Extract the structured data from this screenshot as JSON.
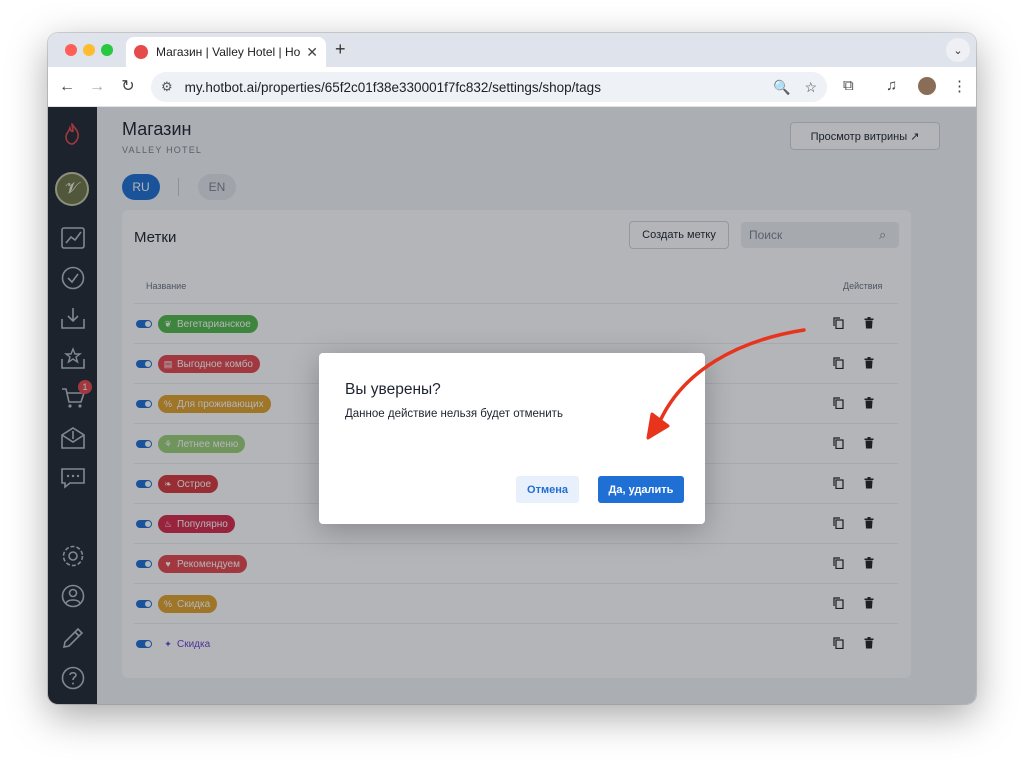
{
  "browser": {
    "tab_title": "Магазин | Valley Hotel | Hotbot",
    "url": "my.hotbot.ai/properties/65f2c01f38e330001f7fc832/settings/shop/tags",
    "new_tab_symbol": "+",
    "tab_close_symbol": "✕"
  },
  "header": {
    "title": "Магазин",
    "subtitle": "VALLEY HOTEL",
    "preview_button": "Просмотр витрины ↗"
  },
  "languages": [
    {
      "code": "RU",
      "active": true
    },
    {
      "code": "EN",
      "active": false
    }
  ],
  "sidebar": {
    "cart_badge": "1"
  },
  "tags_card": {
    "title": "Метки",
    "create_button": "Создать метку",
    "search_placeholder": "Поиск",
    "col_name": "Название",
    "col_actions": "Действия",
    "rows": [
      {
        "label": "Вегетарианское",
        "color": "#52b84a",
        "icon": "leaf-icon",
        "enabled": true
      },
      {
        "label": "Выгодное комбо",
        "color": "#e5484d",
        "icon": "combo-icon",
        "enabled": true
      },
      {
        "label": "Для проживающих",
        "color": "#e2a12a",
        "icon": "percent-icon",
        "enabled": true
      },
      {
        "label": "Летнее меню",
        "color": "#9bd07a",
        "icon": "sprout-icon",
        "enabled": true
      },
      {
        "label": "Острое",
        "color": "#d7383c",
        "icon": "pepper-icon",
        "enabled": true
      },
      {
        "label": "Популярно",
        "color": "#d8294a",
        "icon": "fire-icon",
        "enabled": true
      },
      {
        "label": "Рекомендуем",
        "color": "#e5484d",
        "icon": "heart-icon",
        "enabled": true
      },
      {
        "label": "Скидка",
        "color": "#e2a12a",
        "icon": "percent-icon",
        "enabled": true
      },
      {
        "label": "Скидка",
        "color": "#6d3fd6",
        "icon": "sparkle-icon",
        "enabled": true,
        "outline": true
      }
    ]
  },
  "dialog": {
    "title": "Вы уверены?",
    "message": "Данное действие нельзя будет отменить",
    "cancel": "Отмена",
    "confirm": "Да, удалить"
  },
  "colors": {
    "accent": "#1f6fd4",
    "sidebar": "#232932",
    "annotation_arrow": "#e8341c"
  }
}
